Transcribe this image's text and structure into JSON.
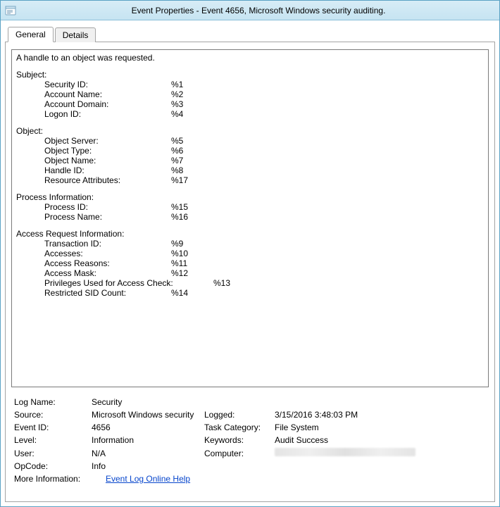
{
  "window": {
    "title": "Event Properties - Event 4656, Microsoft Windows security auditing."
  },
  "tabs": {
    "general": "General",
    "details": "Details"
  },
  "desc": {
    "header": "A handle to an object was requested.",
    "subject": {
      "label": "Subject:",
      "security_id_k": "Security ID:",
      "security_id_v": "%1",
      "account_name_k": "Account Name:",
      "account_name_v": "%2",
      "account_domain_k": "Account Domain:",
      "account_domain_v": "%3",
      "logon_id_k": "Logon ID:",
      "logon_id_v": "%4"
    },
    "object": {
      "label": "Object:",
      "object_server_k": "Object Server:",
      "object_server_v": "%5",
      "object_type_k": "Object Type:",
      "object_type_v": "%6",
      "object_name_k": "Object Name:",
      "object_name_v": "%7",
      "handle_id_k": "Handle ID:",
      "handle_id_v": "%8",
      "res_attr_k": "Resource Attributes:",
      "res_attr_v": "%17"
    },
    "process": {
      "label": "Process Information:",
      "process_id_k": "Process ID:",
      "process_id_v": "%15",
      "process_name_k": "Process Name:",
      "process_name_v": "%16"
    },
    "access": {
      "label": "Access Request Information:",
      "transaction_id_k": "Transaction ID:",
      "transaction_id_v": "%9",
      "accesses_k": "Accesses:",
      "accesses_v": "%10",
      "access_reasons_k": "Access Reasons:",
      "access_reasons_v": "%11",
      "access_mask_k": "Access Mask:",
      "access_mask_v": "%12",
      "priv_check_k": "Privileges Used for Access Check:",
      "priv_check_v": "%13",
      "restricted_sid_k": "Restricted SID Count:",
      "restricted_sid_v": "%14"
    }
  },
  "meta": {
    "log_name_k": "Log Name:",
    "log_name_v": "Security",
    "source_k": "Source:",
    "source_v": "Microsoft Windows security",
    "logged_k": "Logged:",
    "logged_v": "3/15/2016 3:48:03 PM",
    "event_id_k": "Event ID:",
    "event_id_v": "4656",
    "task_cat_k": "Task Category:",
    "task_cat_v": "File System",
    "level_k": "Level:",
    "level_v": "Information",
    "keywords_k": "Keywords:",
    "keywords_v": "Audit Success",
    "user_k": "User:",
    "user_v": "N/A",
    "computer_k": "Computer:",
    "computer_v": "",
    "opcode_k": "OpCode:",
    "opcode_v": "Info",
    "more_info_k": "More Information:",
    "more_info_link": "Event Log Online Help"
  }
}
